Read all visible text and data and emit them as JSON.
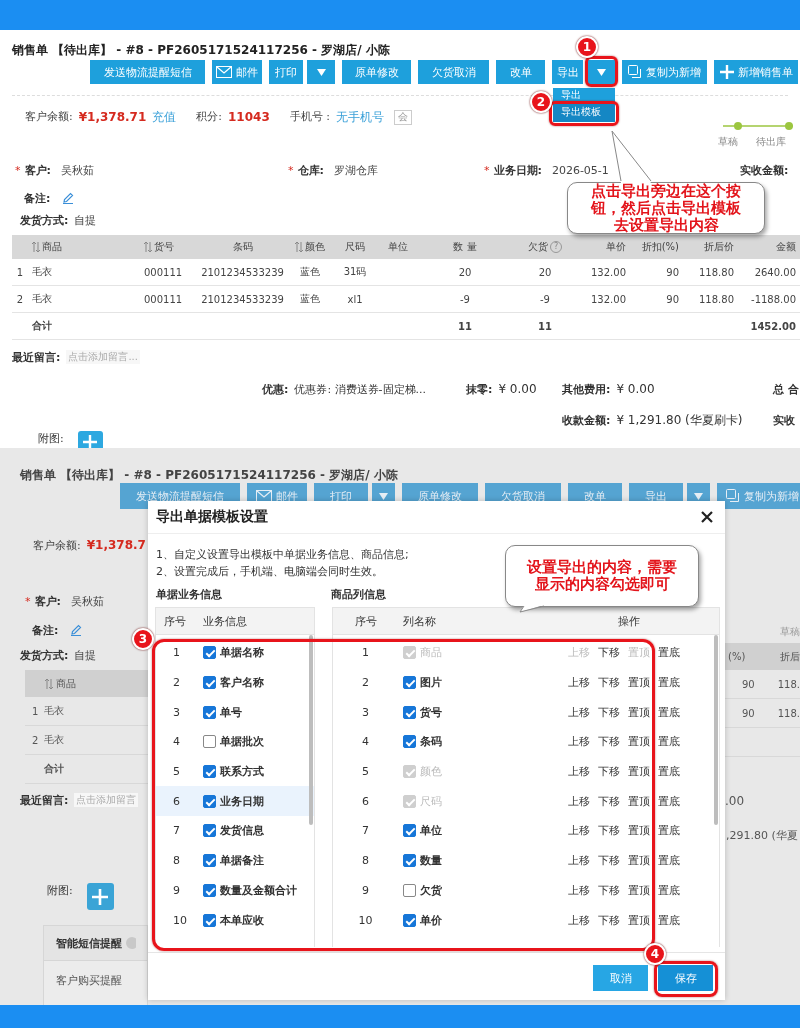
{
  "order_page": {
    "title": "销售单 【待出库】 - #8 - PF2605171524117256 - 罗湖店/ 小陈",
    "toolbar": [
      {
        "label": "发送物流提醒短信",
        "kind": "plain"
      },
      {
        "label": "邮件",
        "kind": "mail"
      },
      {
        "label": "打印",
        "kind": "split"
      },
      {
        "label": "原单修改",
        "kind": "plain"
      },
      {
        "label": "欠货取消",
        "kind": "plain"
      },
      {
        "label": "改单",
        "kind": "plain"
      },
      {
        "label": "导出",
        "kind": "split"
      },
      {
        "label": "复制为新增",
        "kind": "copy"
      },
      {
        "label": "新增销售单",
        "kind": "add"
      }
    ],
    "export_menu": [
      {
        "label": "导出",
        "selected": false
      },
      {
        "label": "导出模板",
        "selected": true
      }
    ],
    "balance": {
      "label": "客户余额:",
      "value": "¥1,378.71",
      "link": "充值"
    },
    "points": {
      "label": "积分:",
      "value": "11043"
    },
    "phone": {
      "label": "手机号 :",
      "value": "无手机号",
      "badge": "会"
    },
    "steps": [
      {
        "label": "草稿"
      },
      {
        "label": "待出库"
      }
    ],
    "fields": [
      {
        "mark": "*",
        "label": "客户:",
        "value": "吴秋茹"
      },
      {
        "mark": "*",
        "label": "仓库:",
        "value": "罗湖仓库"
      },
      {
        "mark": "*",
        "label": "业务日期:",
        "value": "2026-05-1"
      },
      {
        "label": "实收金额:"
      }
    ],
    "remark": {
      "label": "备注:"
    },
    "shipping": {
      "label": "发货方式:",
      "value": "自提"
    },
    "table": {
      "columns": [
        {
          "label": "商品",
          "sortable": true
        },
        {
          "label": "货号",
          "sortable": true
        },
        {
          "label": "条码",
          "sortable": false
        },
        {
          "label": "颜色",
          "sortable": true
        },
        {
          "label": "尺码",
          "sortable": false
        },
        {
          "label": "单位",
          "sortable": false
        },
        {
          "label": "数 量",
          "sortable": false
        },
        {
          "label": "欠货",
          "sortable": false,
          "help": "?"
        },
        {
          "label": "单价",
          "sortable": false
        },
        {
          "label": "折扣(%)",
          "sortable": false
        },
        {
          "label": "折后价",
          "sortable": false
        },
        {
          "label": "金额",
          "sortable": false
        }
      ],
      "rows": [
        {
          "index": "1",
          "cells": [
            "毛衣",
            "000111",
            "2101234533239",
            "蓝色",
            "31码",
            null,
            "20",
            "20",
            "132.00",
            "90",
            "118.80",
            "2640.00"
          ]
        },
        {
          "index": "2",
          "cells": [
            "毛衣",
            "000111",
            "2101234533239",
            "蓝色",
            "xl1",
            null,
            "-9",
            "-9",
            "132.00",
            "90",
            "118.80",
            "-1188.00"
          ]
        }
      ],
      "totals": {
        "label": "合计",
        "qty": "11",
        "backorder": "11",
        "amount": "1452.00"
      }
    },
    "recent_message": {
      "label": "最近留言:",
      "placeholder": "点击添加留言..."
    },
    "summary": {
      "discount": {
        "label": "优惠:",
        "value": "优惠券: 消费送券-固定梯..."
      },
      "rounding": {
        "label": "抹零:",
        "value": "¥ 0.00"
      },
      "other": {
        "label": "其他费用:",
        "value": "¥ 0.00"
      },
      "total": "总 合",
      "received": {
        "label": "收款金额:",
        "value": "¥ 1,291.80 (华夏刷卡)"
      },
      "actual": "实收"
    },
    "attachment": {
      "label": "附图:"
    }
  },
  "dimmed_page": {
    "title": "销售单 【待出库】 - #8 - PF2605171524117256 - 罗湖店/ 小陈",
    "toolbar": [
      {
        "label": "发送物流提醒短信",
        "kind": "plain"
      },
      {
        "label": "邮件",
        "kind": "mail"
      },
      {
        "label": "打印",
        "kind": "split"
      },
      {
        "label": "原单修改",
        "kind": "plain"
      },
      {
        "label": "欠货取消",
        "kind": "plain"
      },
      {
        "label": "改单",
        "kind": "plain"
      },
      {
        "label": "导出",
        "kind": "split"
      },
      {
        "label": "复制为新增",
        "kind": "copy"
      }
    ],
    "balance": {
      "label": "客户余额:",
      "value": "¥1,378.7"
    },
    "step": "草稿",
    "customer": {
      "mark": "*",
      "label": "客户:",
      "value": "吴秋茹"
    },
    "remark": "备注:",
    "shipping": {
      "label": "发货方式:",
      "value": "自提"
    },
    "table": {
      "first_column": "商品",
      "right_columns": [
        "(%)",
        "折后"
      ],
      "rows": [
        {
          "index": "1",
          "name": "毛衣",
          "discount": "90",
          "net_price": "118."
        },
        {
          "index": "2",
          "name": "毛衣",
          "discount": "90",
          "net_price": "118."
        }
      ],
      "totals": "合计"
    },
    "recent_message": {
      "label": "最近留言:",
      "placeholder": "点击添加留言"
    },
    "summary_right": [
      ".00",
      ",291.80 (华夏"
    ],
    "attachment": "附图:",
    "sms_panel": {
      "title": "智能短信提醒",
      "item": "客户购买提醒"
    }
  },
  "dialog": {
    "title": "导出单据模板设置",
    "notes": [
      "1、自定义设置导出模板中单据业务信息、商品信息;",
      "2、设置完成后，手机端、电脑端会同时生效。"
    ],
    "business": {
      "heading": "单据业务信息",
      "columns": [
        "序号",
        "业务信息"
      ],
      "rows": [
        {
          "index": "1",
          "label": "单据名称",
          "checked": true,
          "selected": false
        },
        {
          "index": "2",
          "label": "客户名称",
          "checked": true,
          "selected": false
        },
        {
          "index": "3",
          "label": "单号",
          "checked": true,
          "selected": false
        },
        {
          "index": "4",
          "label": "单据批次",
          "checked": false,
          "selected": false
        },
        {
          "index": "5",
          "label": "联系方式",
          "checked": true,
          "selected": false
        },
        {
          "index": "6",
          "label": "业务日期",
          "checked": true,
          "selected": true
        },
        {
          "index": "7",
          "label": "发货信息",
          "checked": true,
          "selected": false
        },
        {
          "index": "8",
          "label": "单据备注",
          "checked": true,
          "selected": false
        },
        {
          "index": "9",
          "label": "数量及金额合计",
          "checked": true,
          "selected": false
        },
        {
          "index": "10",
          "label": "本单应收",
          "checked": true,
          "selected": false
        }
      ]
    },
    "product": {
      "heading": "商品列信息",
      "columns": [
        "序号",
        "列名称",
        "操作"
      ],
      "rows": [
        {
          "index": "1",
          "label": "商品",
          "checked": true,
          "disabled": true,
          "actions": [
            {
              "label": "上移",
              "disabled": true
            },
            {
              "label": "下移",
              "disabled": false
            },
            {
              "label": "置顶",
              "disabled": true
            },
            {
              "label": "置底",
              "disabled": false
            }
          ]
        },
        {
          "index": "2",
          "label": "图片",
          "checked": true,
          "disabled": false,
          "actions": [
            {
              "label": "上移",
              "disabled": false
            },
            {
              "label": "下移",
              "disabled": false
            },
            {
              "label": "置顶",
              "disabled": false
            },
            {
              "label": "置底",
              "disabled": false
            }
          ]
        },
        {
          "index": "3",
          "label": "货号",
          "checked": true,
          "disabled": false,
          "actions": [
            {
              "label": "上移",
              "disabled": false
            },
            {
              "label": "下移",
              "disabled": false
            },
            {
              "label": "置顶",
              "disabled": false
            },
            {
              "label": "置底",
              "disabled": false
            }
          ]
        },
        {
          "index": "4",
          "label": "条码",
          "checked": true,
          "disabled": false,
          "actions": [
            {
              "label": "上移",
              "disabled": false
            },
            {
              "label": "下移",
              "disabled": false
            },
            {
              "label": "置顶",
              "disabled": false
            },
            {
              "label": "置底",
              "disabled": false
            }
          ]
        },
        {
          "index": "5",
          "label": "颜色",
          "checked": true,
          "disabled": true,
          "actions": [
            {
              "label": "上移",
              "disabled": false
            },
            {
              "label": "下移",
              "disabled": false
            },
            {
              "label": "置顶",
              "disabled": false
            },
            {
              "label": "置底",
              "disabled": false
            }
          ]
        },
        {
          "index": "6",
          "label": "尺码",
          "checked": true,
          "disabled": true,
          "actions": [
            {
              "label": "上移",
              "disabled": false
            },
            {
              "label": "下移",
              "disabled": false
            },
            {
              "label": "置顶",
              "disabled": false
            },
            {
              "label": "置底",
              "disabled": false
            }
          ]
        },
        {
          "index": "7",
          "label": "单位",
          "checked": true,
          "disabled": false,
          "actions": [
            {
              "label": "上移",
              "disabled": false
            },
            {
              "label": "下移",
              "disabled": false
            },
            {
              "label": "置顶",
              "disabled": false
            },
            {
              "label": "置底",
              "disabled": false
            }
          ]
        },
        {
          "index": "8",
          "label": "数量",
          "checked": true,
          "disabled": false,
          "actions": [
            {
              "label": "上移",
              "disabled": false
            },
            {
              "label": "下移",
              "disabled": false
            },
            {
              "label": "置顶",
              "disabled": false
            },
            {
              "label": "置底",
              "disabled": false
            }
          ]
        },
        {
          "index": "9",
          "label": "欠货",
          "checked": false,
          "disabled": false,
          "actions": [
            {
              "label": "上移",
              "disabled": false
            },
            {
              "label": "下移",
              "disabled": false
            },
            {
              "label": "置顶",
              "disabled": false
            },
            {
              "label": "置底",
              "disabled": false
            }
          ]
        },
        {
          "index": "10",
          "label": "单价",
          "checked": true,
          "disabled": false,
          "actions": [
            {
              "label": "上移",
              "disabled": false
            },
            {
              "label": "下移",
              "disabled": false
            },
            {
              "label": "置顶",
              "disabled": false
            },
            {
              "label": "置底",
              "disabled": false
            }
          ]
        }
      ]
    },
    "buttons": [
      {
        "label": "取消",
        "kind": "cancel"
      },
      {
        "label": "保存",
        "kind": "save"
      }
    ]
  },
  "annotations": {
    "markers": [
      "1",
      "2",
      "3",
      "4"
    ],
    "callouts": [
      [
        "点击导出旁边在这个按",
        "钮，然后点击导出模板",
        "去设置导出内容"
      ],
      [
        "设置导出的内容，需要",
        "显示的内容勾选即可"
      ]
    ]
  }
}
